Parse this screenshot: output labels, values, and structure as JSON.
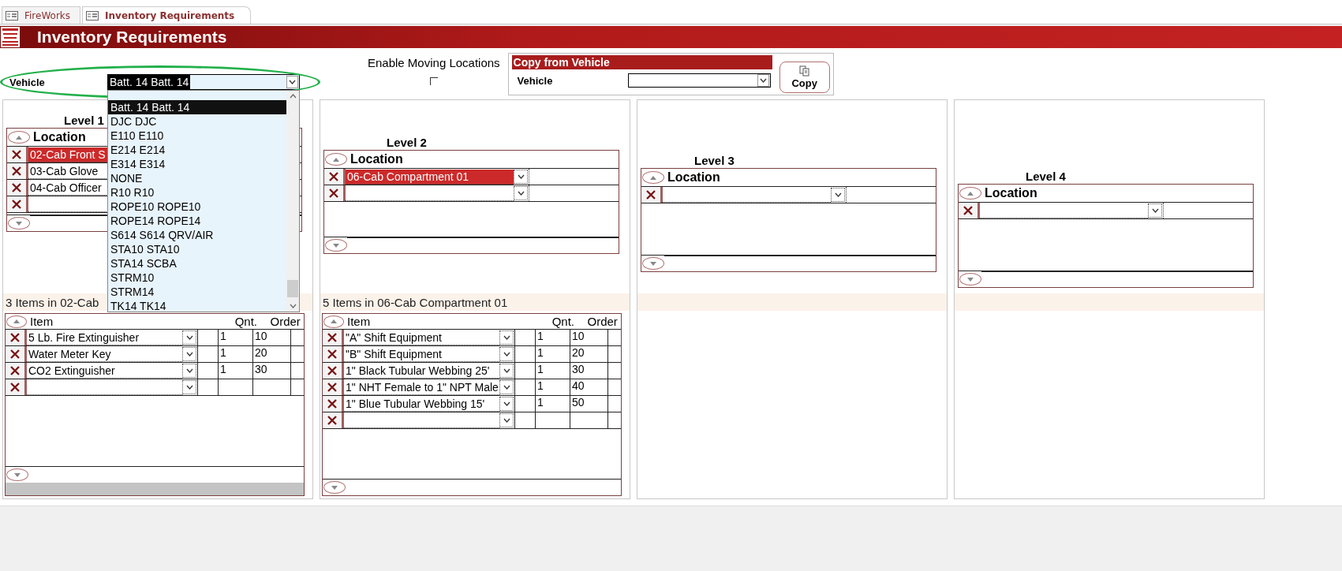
{
  "tabs": [
    {
      "label": "FireWorks",
      "selected": false
    },
    {
      "label": "Inventory Requirements",
      "selected": true
    }
  ],
  "title": "Inventory Requirements",
  "vehicle": {
    "label": "Vehicle",
    "value": "Batt. 14 Batt. 14",
    "expanded": true,
    "options": [
      {
        "label": "Batt. 14 Batt. 14",
        "selected": true
      },
      {
        "label": "DJC DJC",
        "selected": false
      },
      {
        "label": "E110 E110",
        "selected": false
      },
      {
        "label": "E214 E214",
        "selected": false
      },
      {
        "label": "E314 E314",
        "selected": false
      },
      {
        "label": "NONE",
        "selected": false
      },
      {
        "label": "R10 R10",
        "selected": false
      },
      {
        "label": "ROPE10 ROPE10",
        "selected": false
      },
      {
        "label": "ROPE14 ROPE14",
        "selected": false
      },
      {
        "label": "S614 S614 QRV/AIR",
        "selected": false
      },
      {
        "label": "STA10 STA10",
        "selected": false
      },
      {
        "label": "STA14 SCBA",
        "selected": false
      },
      {
        "label": "STRM10",
        "selected": false
      },
      {
        "label": "STRM14",
        "selected": false
      },
      {
        "label": "TK14 TK14",
        "selected": false
      }
    ]
  },
  "enable_moving_locations": {
    "label": "Enable Moving Locations",
    "checked": false
  },
  "copy_from_vehicle": {
    "title": "Copy from Vehicle",
    "vehicle_label": "Vehicle",
    "button": "Copy"
  },
  "levels": [
    {
      "title": "Level 1",
      "location_header": "Location",
      "locations": [
        {
          "name": "02-Cab Front S",
          "selected": true
        },
        {
          "name": "03-Cab Glove",
          "selected": false
        },
        {
          "name": "04-Cab Officer",
          "selected": false
        }
      ],
      "items_caption": "3 Items in 02-Cab",
      "item_columns": [
        "Item",
        "Qnt.",
        "Order"
      ],
      "items": [
        {
          "item": "5 Lb. Fire Extinguisher",
          "qnt": "1",
          "order": "10"
        },
        {
          "item": "Water Meter Key",
          "qnt": "1",
          "order": "20"
        },
        {
          "item": "CO2 Extinguisher",
          "qnt": "1",
          "order": "30"
        }
      ]
    },
    {
      "title": "Level 2",
      "location_header": "Location",
      "locations": [
        {
          "name": "06-Cab Compartment 01",
          "selected": true
        }
      ],
      "items_caption": "5 Items in 06-Cab Compartment 01",
      "item_columns": [
        "Item",
        "Qnt.",
        "Order"
      ],
      "items": [
        {
          "item": "\"A\" Shift Equipment",
          "qnt": "1",
          "order": "10"
        },
        {
          "item": "\"B\" Shift Equipment",
          "qnt": "1",
          "order": "20"
        },
        {
          "item": "1\" Black Tubular Webbing 25'",
          "qnt": "1",
          "order": "30"
        },
        {
          "item": "1\" NHT Female to 1\" NPT Male",
          "qnt": "1",
          "order": "40"
        },
        {
          "item": "1\" Blue Tubular Webbing 15'",
          "qnt": "1",
          "order": "50"
        }
      ]
    },
    {
      "title": "Level 3",
      "location_header": "Location"
    },
    {
      "title": "Level 4",
      "location_header": "Location"
    }
  ]
}
